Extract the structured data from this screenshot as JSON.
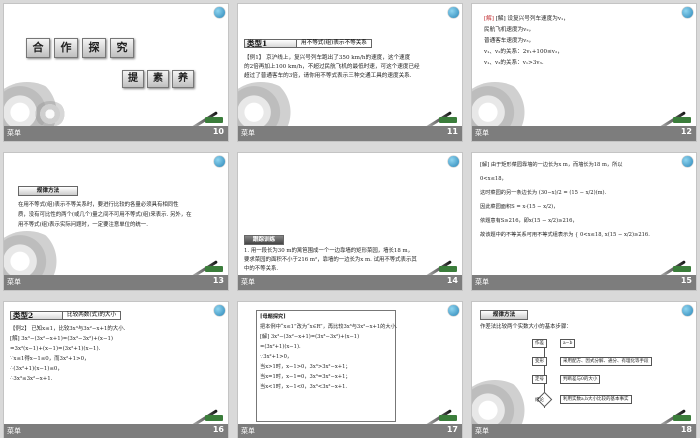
{
  "slides": [
    {
      "page": "10",
      "title_chars": [
        "合",
        "作",
        "探",
        "究"
      ],
      "sub_chars": [
        "提",
        "素",
        "养"
      ],
      "footer": "菜单",
      "tag": "创新导航"
    },
    {
      "page": "11",
      "label": "类型1",
      "title": "用不等式(组)表示不等关系",
      "lines": [
        "【例1】 京沪线上，复兴号列车跑出了350 km/h的速度，这个速度",
        "的2倍再加上100 km/h，不超过民航飞机的最低时速，可这个速度已经",
        "超过了普通客车的3倍，请你用不等式表示三种交通工具的速度关系."
      ],
      "footer": "菜单",
      "tag": "创新导航"
    },
    {
      "page": "12",
      "lines": [
        "[解] 设复兴号列车速度为v₁，",
        "民航飞机速度为v₂，",
        "普通客车速度为v₃，",
        "v₁、v₂的关系：2v₁+100≤v₂，",
        "v₁、v₃的关系：v₁>3v₃."
      ],
      "footer": "菜单",
      "tag": "创新导航"
    },
    {
      "page": "13",
      "header": "规律方法",
      "lines": [
        "在用不等式(组)表示不等关系时，要进行比较的各量必须具有相同性",
        "质，没有可比性的两个(或几个)量之间不可用不等式(组)来表示. 另外，在",
        "用不等式(组)表示实际问题时，一定要注意单位的统一."
      ],
      "footer": "菜单",
      "tag": "创新导航"
    },
    {
      "page": "14",
      "header": "跟踪训练",
      "lines": [
        "1. 用一段长为30 m的篱笆围成一个一边靠墙的矩形菜园，墙长18 m，",
        "要求菜园的面积不小于216 m²，靠墙的一边长为x m. 试用不等式表示其",
        "中的不等关系."
      ],
      "footer": "菜单",
      "tag": "创新导航"
    },
    {
      "page": "15",
      "lines": [
        "[解] 由于矩形菜园靠墙的一边长为x m，而墙长为18 m，所以",
        "0<x≤18，",
        "这时菜园的另一条边长为 (30−x)/2 = (15 − x/2)(m).",
        "因此菜园面积S = x·(15 − x/2)，",
        "依题意有S≥216，即x(15 − x/2)≥216，",
        "故该题中的不等关系可用不等式组表示为 { 0<x≤18, x(15 − x/2)≥216."
      ],
      "footer": "菜单",
      "tag": "创新导航"
    },
    {
      "page": "16",
      "label": "类型2",
      "title": "比较两数(式)的大小",
      "lines": [
        "【例2】 已知x≤1，比较3x³与3x²−x+1的大小.",
        "[解] 3x³−(3x²−x+1)=(3x³−3x²)+(x−1)",
        "=3x²(x−1)+(x−1)=(3x²+1)(x−1).",
        "∵x≤1得x−1≤0，而3x²+1>0，",
        "∴(3x²+1)(x−1)≤0，",
        "∴3x³≤3x²−x+1."
      ],
      "footer": "菜单",
      "tag": "创新导航"
    },
    {
      "page": "17",
      "header": "[母题探究]",
      "lines": [
        "把本例中“x≤1”改为“x∈R”，再比较3x³与3x²−x+1的大小.",
        "[解] 3x³−(3x²−x+1)=(3x³−3x²)+(x−1)",
        "=(3x²+1)(x−1).",
        "∵3x²+1>0，",
        "当x>1时，x−1>0，3x³>3x²−x+1；",
        "当x=1时，x−1=0，3x³=3x²−x+1；",
        "当x<1时，x−1<0，3x³<3x²−x+1."
      ],
      "footer": "菜单",
      "tag": "创新导航"
    },
    {
      "page": "18",
      "header": "规律方法",
      "intro": "作差法比较两个实数大小的基本步骤：",
      "flow": {
        "step1": "作差",
        "note1": "a−b",
        "step2": "变形",
        "note2": "采用配方、因式分解、通分、有理化等手段",
        "step3": "定号",
        "note3": "判断差与0的大小",
        "step4": "结论",
        "note4": "利用实数a,b大小比较的基本事实"
      },
      "footer": "菜单",
      "tag": "创新导航"
    }
  ]
}
